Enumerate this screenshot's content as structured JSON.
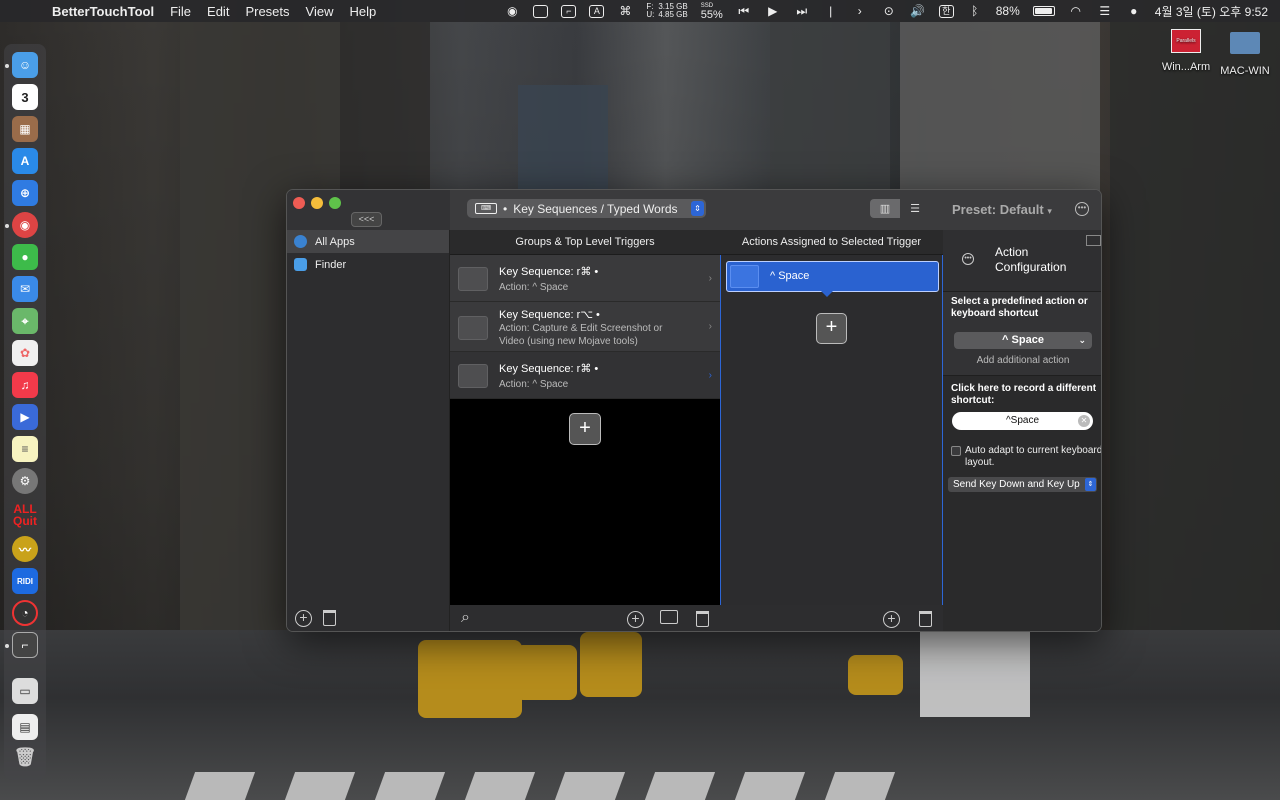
{
  "menubar": {
    "app_name": "BetterTouchTool",
    "menus": [
      "File",
      "Edit",
      "Presets",
      "View",
      "Help"
    ],
    "stats": {
      "f_label": "F:",
      "u_label": "U:",
      "f_value": "3.15 GB",
      "u_value": "4.85 GB",
      "ssd_label": "SSD",
      "ssd_value": "55%"
    },
    "battery": "88%",
    "clock": "4월 3일 (토) 오후 9:52",
    "input_source": "한"
  },
  "desktop": {
    "item1": "Win...Arm",
    "item2": "MAC-WIN",
    "parallels_badge": "Parallels"
  },
  "dock": {
    "calendar_day": "3",
    "allquit_line1": "ALL",
    "allquit_line2": "Quit",
    "ridi_label": "RIDI"
  },
  "window": {
    "collapse_label": "<<<",
    "trigger_type": "Key Sequences / Typed Words",
    "preset_label": "Preset: Default",
    "preset_arrow": "▾"
  },
  "sidebar": {
    "items": [
      {
        "label": "All Apps",
        "selected": true
      },
      {
        "label": "Finder",
        "selected": false
      }
    ]
  },
  "columns": {
    "triggers_header": "Groups & Top Level Triggers",
    "actions_header": "Actions Assigned to Selected Trigger"
  },
  "triggers": [
    {
      "title": "Key Sequence: r⌘ •",
      "action": "Action: ^ Space"
    },
    {
      "title": "Key Sequence: r⌥ •",
      "action": "Action: Capture & Edit Screenshot or Video (using new Mojave tools)"
    },
    {
      "title": "Key Sequence: r⌘ •",
      "action": "Action: ^ Space"
    }
  ],
  "actions": [
    {
      "label": "^ Space",
      "selected": true
    }
  ],
  "config": {
    "title_line1": "Action",
    "title_line2": "Configuration",
    "predefined_label": "Select a predefined action or keyboard shortcut",
    "shortcut_value": "^ Space",
    "add_additional": "Add additional action",
    "record_label": "Click here to record a different shortcut:",
    "record_value": "^Space",
    "auto_adapt_label": "Auto adapt to current keyboard layout.",
    "auto_adapt_checked": false,
    "send_mode": "Send Key Down and Key Up"
  },
  "colors": {
    "accent": "#2a62d0",
    "window_bg": "#2a2a2b"
  }
}
